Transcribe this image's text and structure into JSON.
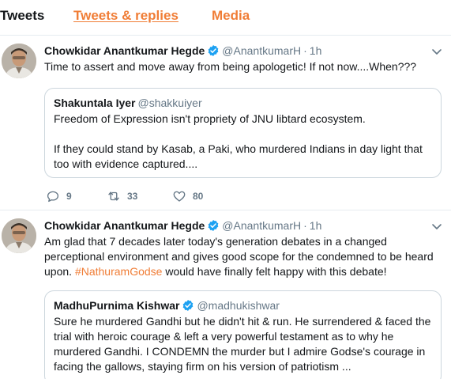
{
  "tabs": {
    "tweets": "Tweets",
    "replies": "Tweets & replies",
    "media": "Media"
  },
  "colors": {
    "accent": "#f07d36",
    "verified": "#1da1f2",
    "muted": "#657786",
    "border": "#e6ecf0"
  },
  "tweets": [
    {
      "name": "Chowkidar Anantkumar Hegde",
      "handle": "@AnantkumarH",
      "dot": "·",
      "time": "1h",
      "text": "Time to assert and move away from being apologetic!  If not now....When???",
      "quote": {
        "name": "Shakuntala Iyer",
        "handle": "@shakkuiyer",
        "text_line1": "Freedom of Expression isn't propriety of JNU libtard ecosystem.",
        "text_line2": "If they could stand by Kasab, a Paki, who murdered Indians in day light that too with evidence captured...."
      },
      "replies": "9",
      "retweets": "33",
      "likes": "80"
    },
    {
      "name": "Chowkidar Anantkumar Hegde",
      "handle": "@AnantkumarH",
      "dot": "·",
      "time": "1h",
      "text_before": "Am glad that 7 decades later today's generation debates in a changed perceptional environment and gives good scope for the  condemned to be heard upon.  ",
      "hashtag": "#NathuramGodse",
      "text_after": " would have finally felt happy with this debate!",
      "quote": {
        "name": "MadhuPurnima Kishwar",
        "handle": "@madhukishwar",
        "text": "Sure he murdered Gandhi but he didn't hit & run. He surrendered & faced the trial with heroic courage & left a very powerful testament as to why he murdered Gandhi. I CONDEMN the murder but I admire Godse's courage in facing the gallows, staying firm on his version of patriotism ..."
      }
    }
  ]
}
